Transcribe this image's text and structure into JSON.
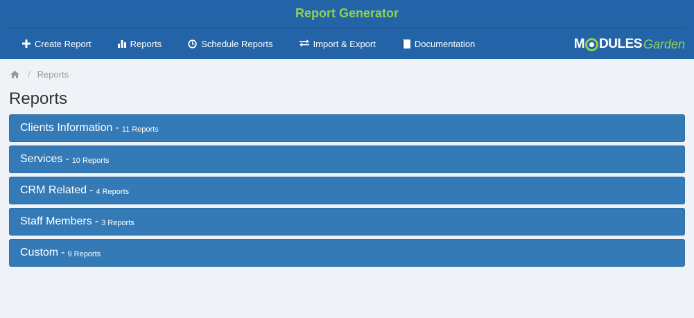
{
  "app": {
    "title": "Report Generator"
  },
  "nav": {
    "items": [
      {
        "label": "Create Report",
        "icon": "plus-icon"
      },
      {
        "label": "Reports",
        "icon": "bar-chart-icon"
      },
      {
        "label": "Schedule Reports",
        "icon": "clock-icon"
      },
      {
        "label": "Import & Export",
        "icon": "exchange-icon"
      },
      {
        "label": "Documentation",
        "icon": "book-icon"
      }
    ]
  },
  "brand": {
    "part1": "M",
    "part2": "DULES",
    "part3": "Garden"
  },
  "breadcrumb": {
    "home_icon": "home-icon",
    "separator": "/",
    "current": "Reports"
  },
  "page": {
    "title": "Reports"
  },
  "groups": [
    {
      "name": "Clients Information",
      "dash": "-",
      "count": "11 Reports"
    },
    {
      "name": "Services",
      "dash": "-",
      "count": "10 Reports"
    },
    {
      "name": "CRM Related",
      "dash": "-",
      "count": "4 Reports"
    },
    {
      "name": "Staff Members",
      "dash": "-",
      "count": "3 Reports"
    },
    {
      "name": "Custom",
      "dash": "-",
      "count": "9 Reports"
    }
  ],
  "colors": {
    "header": "#2363a8",
    "accent": "#8fd14f",
    "panel": "#337ab7",
    "background": "#eff2f7"
  }
}
